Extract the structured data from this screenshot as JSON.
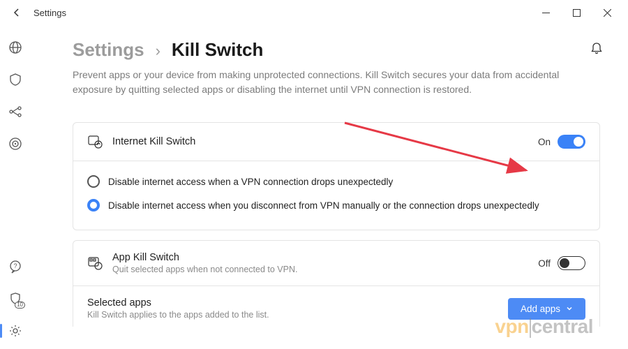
{
  "titlebar": {
    "title": "Settings"
  },
  "sidebar": {
    "items": [
      {
        "name": "globe-icon"
      },
      {
        "name": "shield-icon"
      },
      {
        "name": "mesh-icon"
      },
      {
        "name": "target-icon"
      }
    ],
    "bottom": [
      {
        "name": "chat-icon"
      },
      {
        "name": "guard-icon",
        "badge": "10"
      },
      {
        "name": "gear-icon",
        "active": true
      }
    ]
  },
  "breadcrumb": {
    "root": "Settings",
    "sep": "›",
    "current": "Kill Switch"
  },
  "description": "Prevent apps or your device from making unprotected connections. Kill Switch secures your data from accidental exposure by quitting selected apps or disabling the internet until VPN connection is restored.",
  "internet_ks": {
    "title": "Internet Kill Switch",
    "state_label": "On",
    "state": "on",
    "options": [
      {
        "label": "Disable internet access when a VPN connection drops unexpectedly",
        "selected": false
      },
      {
        "label": "Disable internet access when you disconnect from VPN manually or the connection drops unexpectedly",
        "selected": true
      }
    ]
  },
  "app_ks": {
    "title": "App Kill Switch",
    "subtitle": "Quit selected apps when not connected to VPN.",
    "state_label": "Off",
    "state": "off"
  },
  "selected_apps": {
    "title": "Selected apps",
    "subtitle": "Kill Switch applies to the apps added to the list.",
    "button": "Add apps"
  },
  "watermark": {
    "pre": "vpn",
    "post": "central"
  },
  "colors": {
    "accent": "#3a82f7",
    "arrow": "#e63946"
  }
}
